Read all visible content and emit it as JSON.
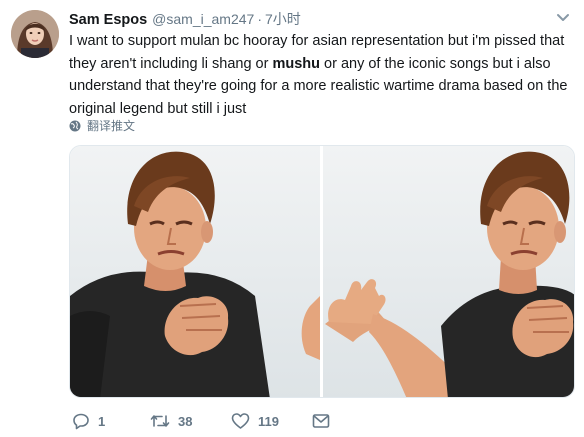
{
  "author": {
    "display_name": "Sam Espos",
    "handle": "@sam_i_am247",
    "separator": "·",
    "time": "7小时"
  },
  "tweet": {
    "text_part1": "I want to support mulan bc hooray for asian representation but i'm pissed that they aren't including li shang or ",
    "text_bold": "mushu",
    "text_part2": " or any of the iconic songs but i also understand that they're going for a more realistic wartime drama based on the original legend but still i just"
  },
  "translate": {
    "label": "翻译推文"
  },
  "actions": {
    "reply_count": "1",
    "retweet_count": "38",
    "like_count": "119"
  },
  "icons": {
    "menu": "chevron-down-icon",
    "translate": "globe-icon",
    "reply": "reply-icon",
    "retweet": "retweet-icon",
    "like": "heart-icon",
    "message": "envelope-icon"
  },
  "colors": {
    "text": "#14171a",
    "secondary": "#657786",
    "sky": "#e8ecee"
  }
}
